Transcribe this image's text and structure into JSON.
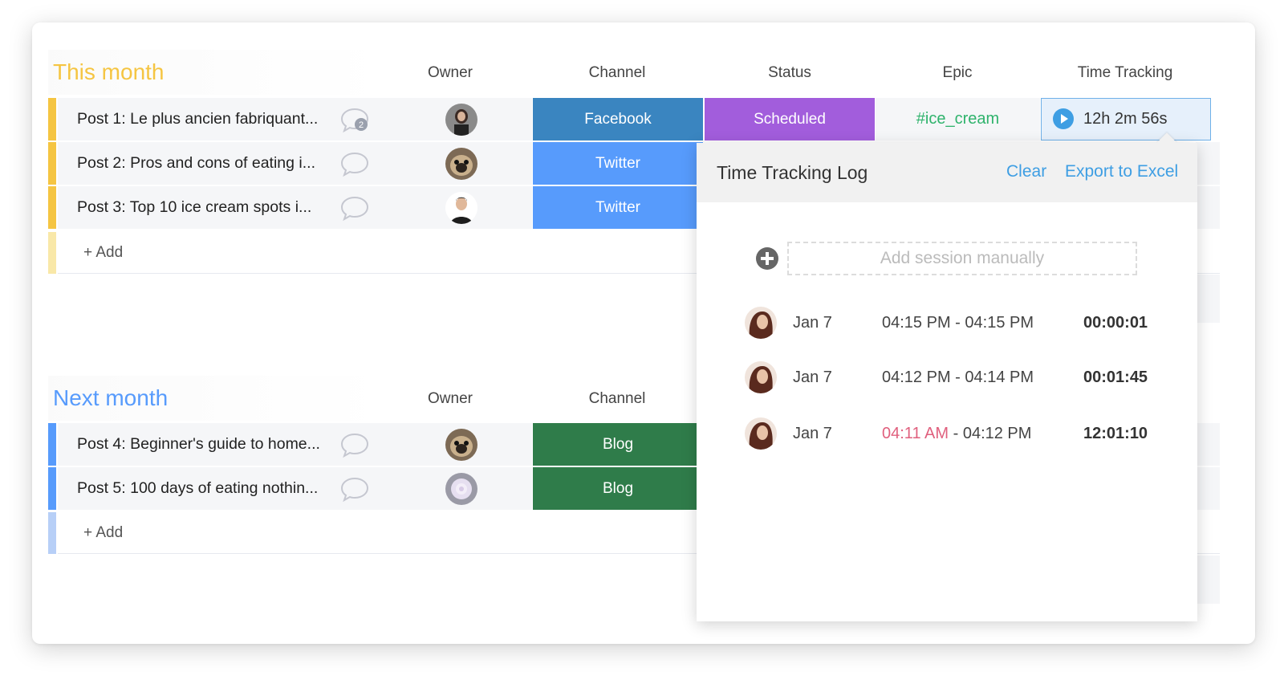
{
  "groups": [
    {
      "title": "This month",
      "title_color": "#f5c542",
      "accent": "#f5c542",
      "accent_light": "#f9e8a8",
      "columns": [
        "Owner",
        "Channel",
        "Status",
        "Epic",
        "Time Tracking"
      ],
      "add_label": "+ Add",
      "rows": [
        {
          "name": "Post 1: Le plus ancien fabriquant...",
          "comments": "2",
          "owner_icon": "woman-avatar",
          "channel": "Facebook",
          "channel_color": "#3a85c0",
          "status": "Scheduled",
          "status_color": "#a25ddc",
          "epic": "#ice_cream",
          "time": "12h 2m 56s"
        },
        {
          "name": "Post 2: Pros and cons of eating i...",
          "comments": "",
          "owner_icon": "pug-avatar",
          "channel": "Twitter",
          "channel_color": "#579bfc"
        },
        {
          "name": "Post 3: Top 10 ice cream spots i...",
          "comments": "",
          "owner_icon": "man-avatar",
          "channel": "Twitter",
          "channel_color": "#579bfc"
        }
      ]
    },
    {
      "title": "Next month",
      "title_color": "#579bfc",
      "accent": "#579bfc",
      "accent_light": "#b7cff7",
      "columns": [
        "Owner",
        "Channel"
      ],
      "add_label": "+ Add",
      "rows": [
        {
          "name": "Post 4: Beginner's guide to home...",
          "comments": "",
          "owner_icon": "pug-avatar",
          "channel": "Blog",
          "channel_color": "#2f7c4a"
        },
        {
          "name": "Post 5: 100 days of eating nothin...",
          "comments": "",
          "owner_icon": "flower-avatar",
          "channel": "Blog",
          "channel_color": "#2f7c4a"
        }
      ]
    }
  ],
  "time_log": {
    "title": "Time Tracking Log",
    "clear_label": "Clear",
    "export_label": "Export to Excel",
    "add_placeholder": "Add session manually",
    "sessions": [
      {
        "date": "Jan 7",
        "start": "04:15 PM",
        "sep": "-",
        "end": "04:15 PM",
        "duration": "00:00:01",
        "start_warn": false
      },
      {
        "date": "Jan 7",
        "start": "04:12 PM",
        "sep": "-",
        "end": "04:14 PM",
        "duration": "00:01:45",
        "start_warn": false
      },
      {
        "date": "Jan 7",
        "start": "04:11 AM",
        "sep": "-",
        "end": "04:12 PM",
        "duration": "12:01:10",
        "start_warn": true
      }
    ]
  }
}
